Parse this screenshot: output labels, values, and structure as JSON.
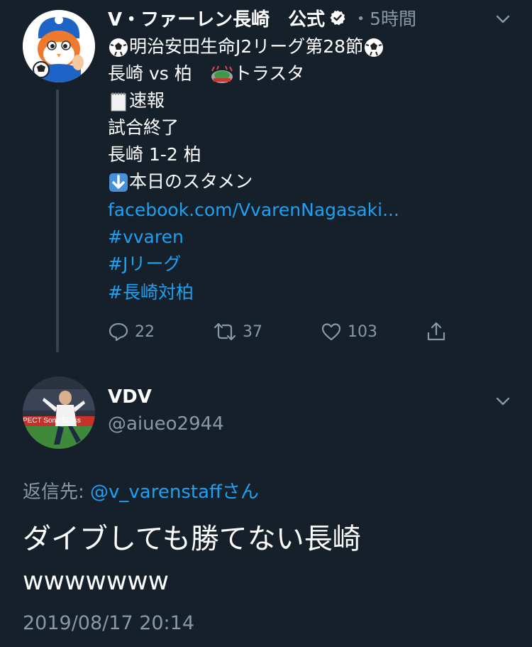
{
  "tweet1": {
    "name": "V・ファーレン長崎　公式",
    "time": "・5時間",
    "lines": [
      "明治安田生命J2リーグ第28節",
      "長崎 vs 柏　",
      "トラスタ",
      "速報",
      "試合終了",
      "長崎 1-2 柏",
      "本日のスタメン"
    ],
    "link": "facebook.com/VvarenNagasaki...",
    "hashtags": [
      "#vvaren",
      "#Jリーグ",
      "#長崎対柏"
    ],
    "replies": "22",
    "retweets": "37",
    "likes": "103"
  },
  "tweet2": {
    "name": "VDV",
    "handle": "@aiueo2944",
    "reply_prefix": "返信先: ",
    "reply_user": "@v_varenstaff",
    "reply_suffix": "さん",
    "text": "ダイブしても勝てない長崎",
    "text2": "wwwwwww",
    "timestamp": "2019/08/17 20:14",
    "avatar_banner_text": "PECT Sony Ericss"
  },
  "colors": {
    "background": "#15202b",
    "muted": "#8899a6",
    "link": "#1da1f2"
  }
}
